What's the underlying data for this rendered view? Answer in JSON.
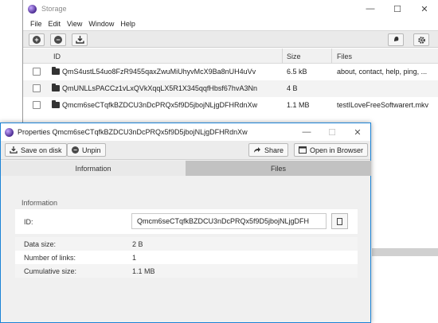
{
  "main_window": {
    "title": "Storage",
    "menu": [
      "File",
      "Edit",
      "View",
      "Window",
      "Help"
    ],
    "table": {
      "headers": {
        "id": "ID",
        "size": "Size",
        "files": "Files"
      },
      "rows": [
        {
          "id": "QmS4ustL54uo8FzR9455qaxZwuMiUhyvMcX9Ba8nUH4uVv",
          "size": "6.5 kB",
          "files": "about, contact, help, ping, ..."
        },
        {
          "id": "QmUNLLsPACCz1vLxQVkXqqLX5R1X345qqfHbsf67hvA3Nn",
          "size": "4 B",
          "files": ""
        },
        {
          "id": "Qmcm6seCTqfkBZDCU3nDcPRQx5f9D5jbojNLjgDFHRdnXw",
          "size": "1.1 MB",
          "files": "testILoveFreeSoftwarert.mkv"
        }
      ]
    }
  },
  "dialog": {
    "title": "Properties Qmcm6seCTqfkBZDCU3nDcPRQx5f9D5jbojNLjgDFHRdnXw",
    "toolbar": {
      "save_on_disk": "Save on disk",
      "unpin": "Unpin",
      "share": "Share",
      "open_in_browser": "Open in Browser"
    },
    "tabs": {
      "information": "Information",
      "files": "Files"
    },
    "section_title": "Information",
    "properties": {
      "id_label": "ID:",
      "id_value": "Qmcm6seCTqfkBZDCU3nDcPRQx5f9D5jbojNLjgDFH",
      "data_size_label": "Data size:",
      "data_size_value": "2 B",
      "links_label": "Number of links:",
      "links_value": "1",
      "cumulative_label": "Cumulative size:",
      "cumulative_value": "1.1 MB"
    }
  }
}
